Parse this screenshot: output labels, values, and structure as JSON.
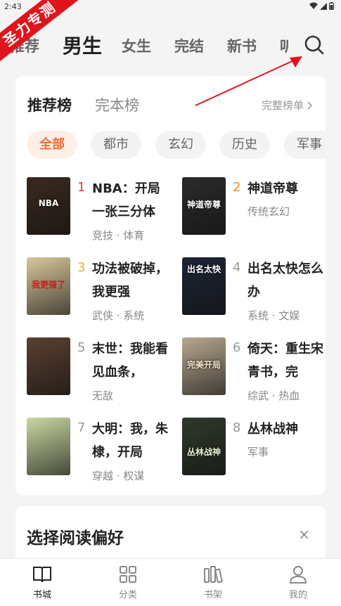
{
  "status_bar": {
    "time": "2:43"
  },
  "watermark": "圣力专测",
  "top_tabs": [
    {
      "label": "推荐",
      "active": false
    },
    {
      "label": "男生",
      "active": true
    },
    {
      "label": "女生",
      "active": false
    },
    {
      "label": "完结",
      "active": false
    },
    {
      "label": "新书",
      "active": false
    },
    {
      "label": "听",
      "active": false
    }
  ],
  "ranking": {
    "tabs": [
      {
        "label": "推荐榜",
        "active": true
      },
      {
        "label": "完本榜",
        "active": false
      }
    ],
    "full_list_label": "完整榜单",
    "chips": [
      {
        "label": "全部",
        "active": true
      },
      {
        "label": "都市",
        "active": false
      },
      {
        "label": "玄幻",
        "active": false
      },
      {
        "label": "历史",
        "active": false
      },
      {
        "label": "军事",
        "active": false
      }
    ],
    "books": [
      {
        "rank": "1",
        "title": "NBA：开局一张三分体",
        "tags": "竞技 · 体育",
        "cover_text": "NBA",
        "cover_color": "#3a2a20",
        "rank_color": "#e8343a"
      },
      {
        "rank": "2",
        "title": "神道帝尊",
        "tags": "传统玄幻",
        "cover_text": "神道帝尊",
        "cover_color": "#2b2b2b",
        "rank_color": "#f28c1e"
      },
      {
        "rank": "3",
        "title": "功法被破掉，我更强",
        "tags": "武侠 · 系统",
        "cover_text": "我更强了",
        "cover_color": "#d8c79a",
        "rank_color": "#f2b01e"
      },
      {
        "rank": "4",
        "title": "出名太快怎么办",
        "tags": "系统 · 文娱",
        "cover_text": "出名太快",
        "cover_color": "#1c2535",
        "rank_color": "#999999"
      },
      {
        "rank": "5",
        "title": "末世：我能看见血条，",
        "tags": "无敌",
        "cover_text": "",
        "cover_color": "#5a4030",
        "rank_color": "#999999"
      },
      {
        "rank": "6",
        "title": "倚天：重生宋青书，完",
        "tags": "综武 · 热血",
        "cover_text": "完美开局",
        "cover_color": "#b8a890",
        "rank_color": "#999999"
      },
      {
        "rank": "7",
        "title": "大明：我，朱棣，开局",
        "tags": "穿越 · 权谋",
        "cover_text": "",
        "cover_color": "#c8d8a0",
        "rank_color": "#999999"
      },
      {
        "rank": "8",
        "title": "丛林战神",
        "tags": "军事",
        "cover_text": "丛林战神",
        "cover_color": "#2e3a2a",
        "rank_color": "#999999"
      }
    ]
  },
  "preference": {
    "title": "选择阅读偏好",
    "close": "×"
  },
  "bottom_nav": [
    {
      "label": "书城",
      "icon": "book-open-icon",
      "active": true
    },
    {
      "label": "分类",
      "icon": "grid-icon",
      "active": false
    },
    {
      "label": "书架",
      "icon": "bookshelf-icon",
      "active": false
    },
    {
      "label": "我的",
      "icon": "user-icon",
      "active": false
    }
  ]
}
